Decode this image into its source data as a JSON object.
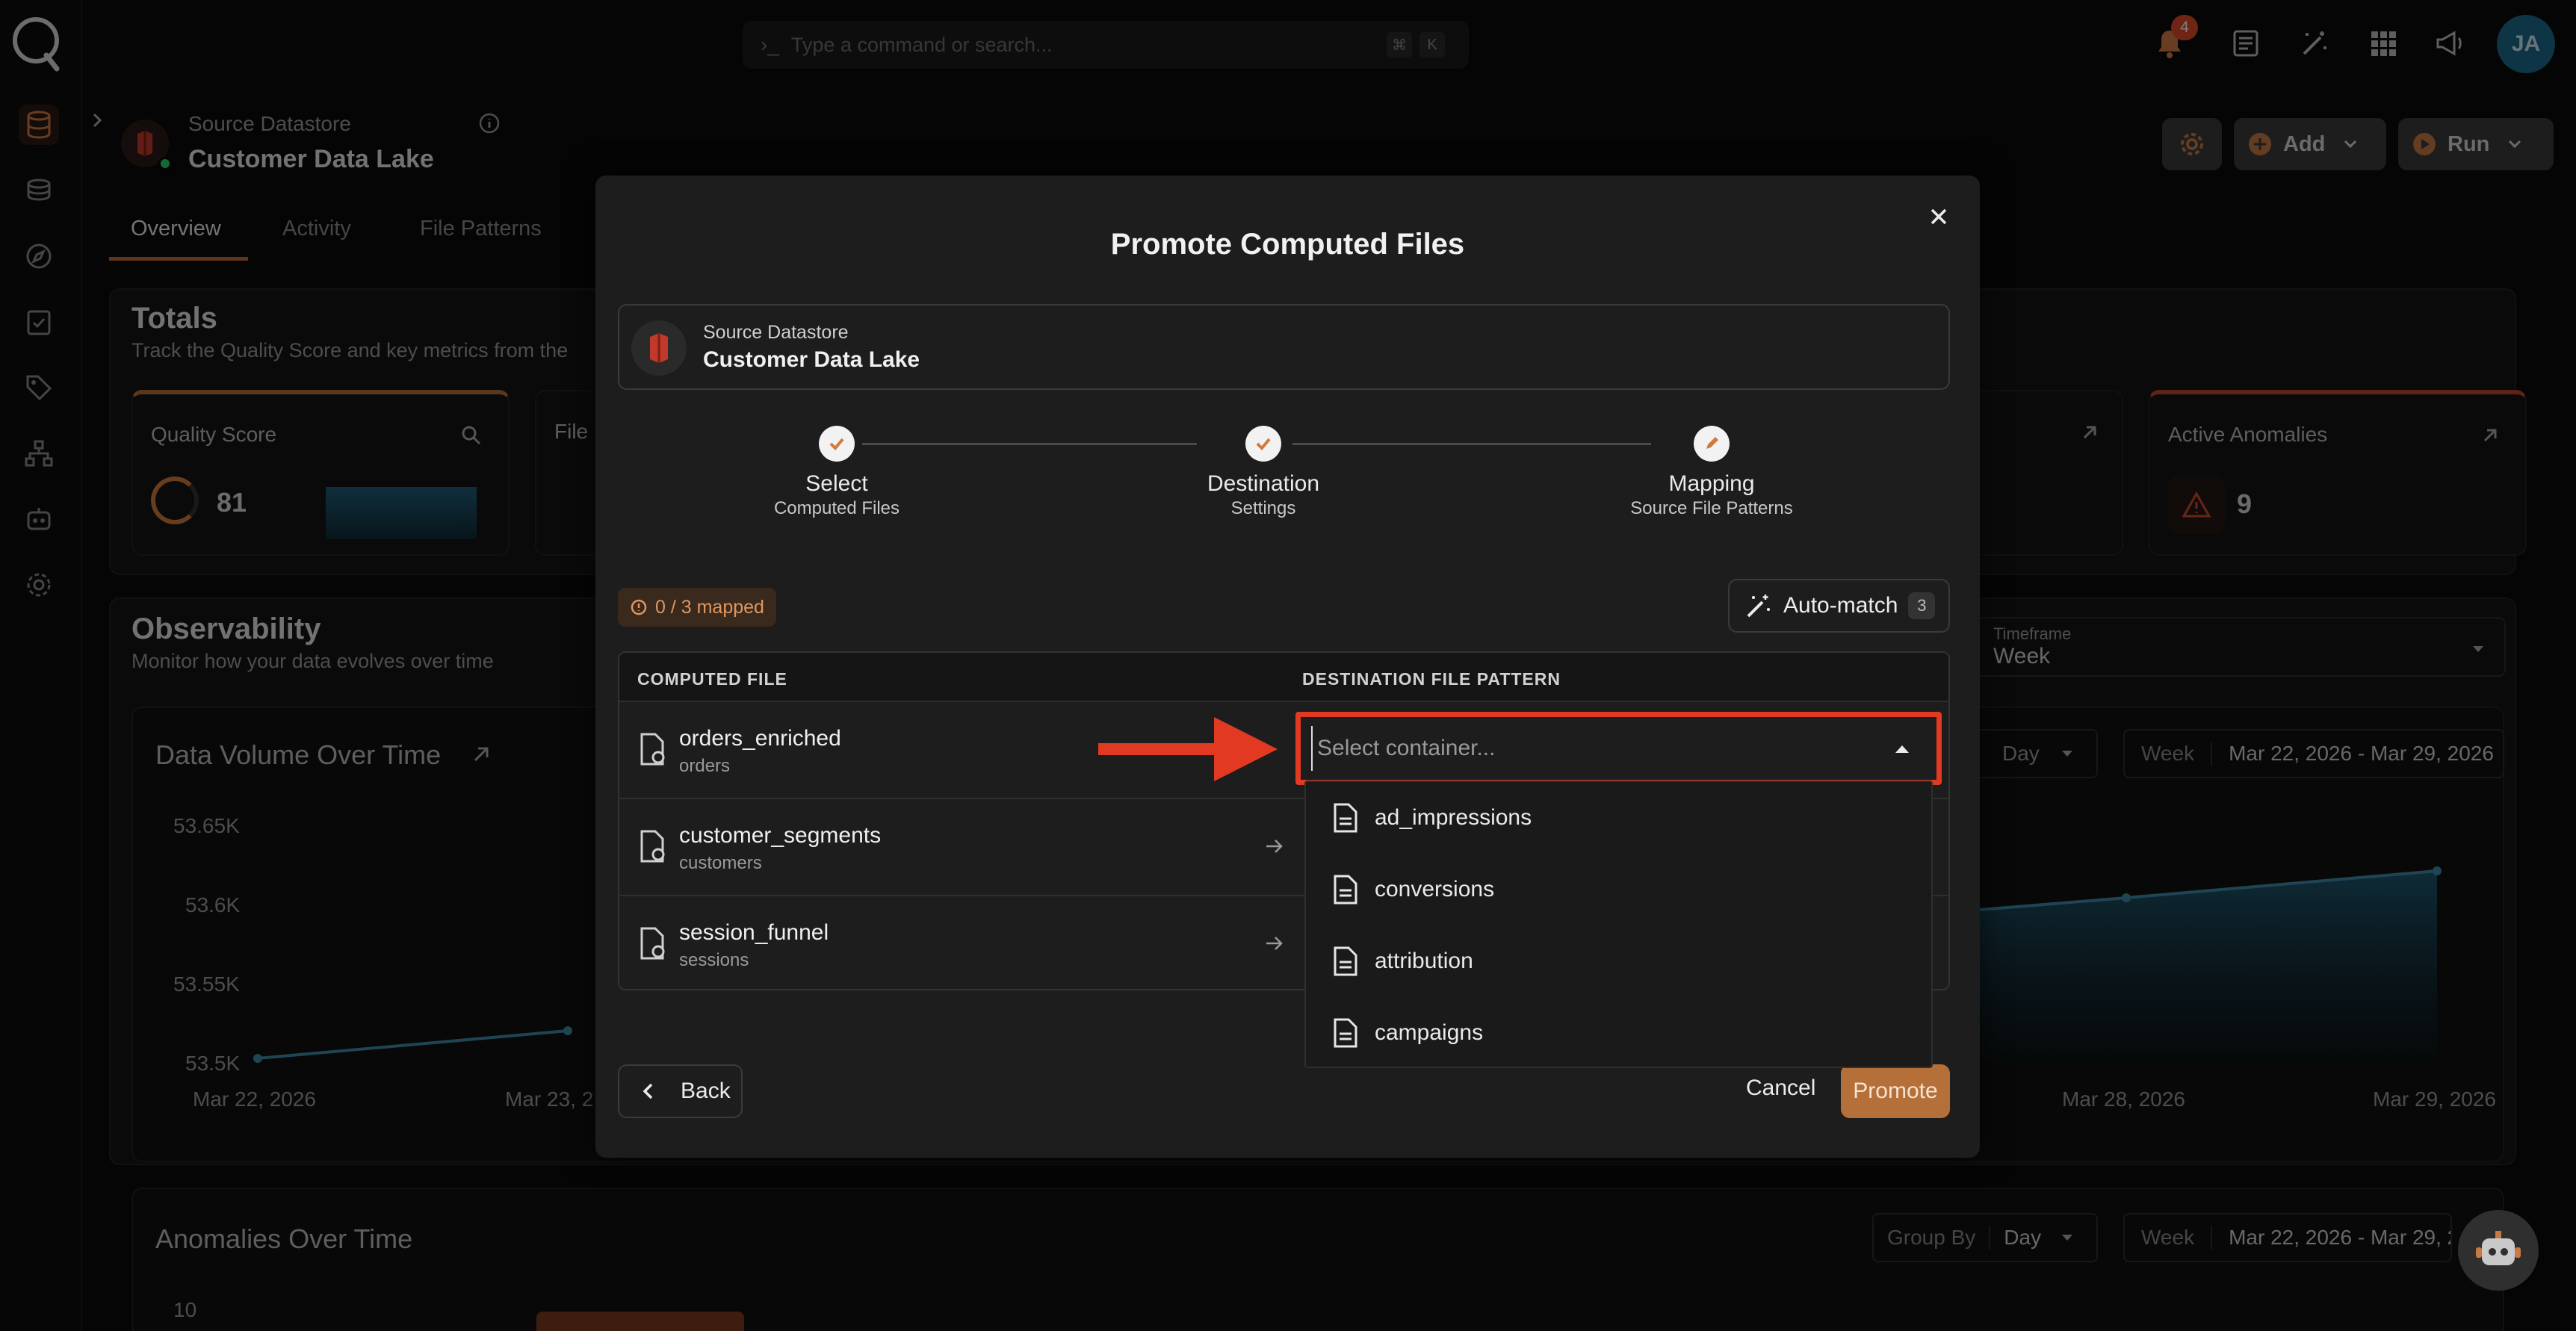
{
  "app": {
    "search_placeholder": "Type a command or search...",
    "kbd_cmd": "⌘",
    "kbd_k": "K",
    "notification_count": "4",
    "user_initials": "JA"
  },
  "page": {
    "datastore_label": "Source Datastore",
    "datastore_name": "Customer Data Lake",
    "tabs": [
      "Overview",
      "Activity",
      "File Patterns"
    ],
    "add_label": "Add",
    "run_label": "Run"
  },
  "background": {
    "totals_title": "Totals",
    "totals_subtitle": "Track the Quality Score and key metrics from the",
    "quality_score_label": "Quality Score",
    "quality_score_value": "81",
    "file_label": "File I",
    "active_anomalies_label": "Active Anomalies",
    "active_anomalies_value": "9",
    "observability_title": "Observability",
    "observability_subtitle": "Monitor how your data evolves over time",
    "timeframe_label": "Timeframe",
    "timeframe_value": "Week",
    "data_volume_title": "Data Volume Over Time",
    "group_by_value": "Day",
    "week_label": "Week",
    "date_range": "Mar 22, 2026 - Mar 29, 2026",
    "date_range_short": "Mar 22, 2026 - Mar 29, 2",
    "anomalies_title": "Anomalies Over Time",
    "group_by_label": "Group By",
    "y_ticks": [
      "53.65K",
      "53.6K",
      "53.55K",
      "53.5K"
    ],
    "x_ticks_left": [
      "Mar 22, 2026",
      "Mar 23, 2"
    ],
    "x_ticks_right": [
      "Mar 28, 2026",
      "Mar 29, 2026"
    ],
    "anomaly_y_tick": "10"
  },
  "modal": {
    "title": "Promote Computed Files",
    "source_label": "Source Datastore",
    "source_name": "Customer Data Lake",
    "steps": [
      {
        "title": "Select",
        "subtitle": "Computed Files"
      },
      {
        "title": "Destination",
        "subtitle": "Settings"
      },
      {
        "title": "Mapping",
        "subtitle": "Source File Patterns"
      }
    ],
    "mapped_badge": "0 / 3 mapped",
    "automatch_label": "Auto-match",
    "automatch_count": "3",
    "col_computed": "COMPUTED FILE",
    "col_destination": "DESTINATION FILE PATTERN",
    "rows": [
      {
        "name": "orders_enriched",
        "sub": "orders"
      },
      {
        "name": "customer_segments",
        "sub": "customers"
      },
      {
        "name": "session_funnel",
        "sub": "sessions"
      }
    ],
    "select_placeholder": "Select container...",
    "options": [
      "ad_impressions",
      "conversions",
      "attribution",
      "campaigns"
    ],
    "back_label": "Back",
    "cancel_label": "Cancel",
    "promote_label": "Promote"
  },
  "colors": {
    "accent": "#b5703a",
    "highlight": "#e23a22",
    "chart_line": "#3f8aa8"
  }
}
